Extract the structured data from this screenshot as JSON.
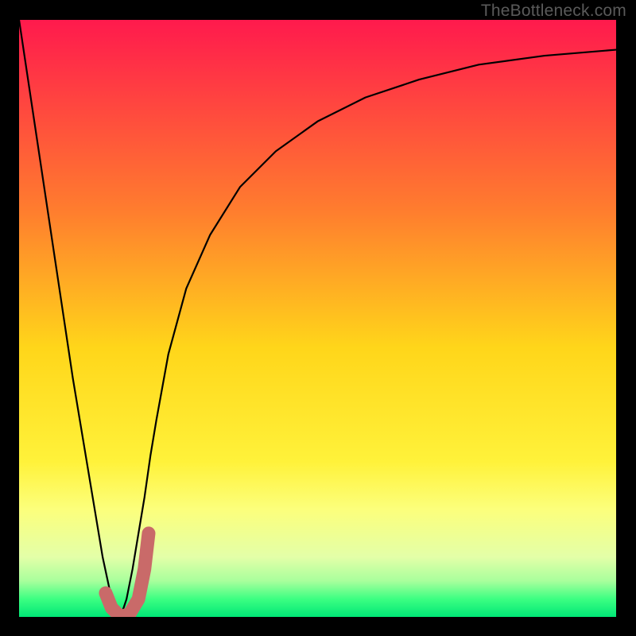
{
  "watermark": {
    "text": "TheBottleneck.com"
  },
  "chart_data": {
    "type": "line",
    "title": "",
    "xlabel": "",
    "ylabel": "",
    "xlim": [
      0,
      100
    ],
    "ylim": [
      0,
      100
    ],
    "grid": false,
    "legend": false,
    "background_gradient_stops": [
      {
        "pos": 0.0,
        "color": "#ff1a4d"
      },
      {
        "pos": 0.32,
        "color": "#ff7d2e"
      },
      {
        "pos": 0.55,
        "color": "#ffd61a"
      },
      {
        "pos": 0.74,
        "color": "#fff23a"
      },
      {
        "pos": 0.82,
        "color": "#fcff7c"
      },
      {
        "pos": 0.9,
        "color": "#e3ffa8"
      },
      {
        "pos": 0.94,
        "color": "#a8ff9c"
      },
      {
        "pos": 0.97,
        "color": "#3cff82"
      },
      {
        "pos": 1.0,
        "color": "#00e676"
      }
    ],
    "series": [
      {
        "name": "bottleneck-curve",
        "color": "#000000",
        "width": 2.2,
        "x": [
          0,
          3,
          6,
          9,
          12,
          14,
          15.5,
          17,
          18,
          19,
          20,
          21,
          22,
          23,
          25,
          28,
          32,
          37,
          43,
          50,
          58,
          67,
          77,
          88,
          100
        ],
        "values": [
          100,
          80,
          60,
          40,
          22,
          10,
          3,
          0,
          3,
          8,
          14,
          20,
          27,
          33,
          44,
          55,
          64,
          72,
          78,
          83,
          87,
          90,
          92.5,
          94,
          95
        ]
      },
      {
        "name": "highlight-j-marker",
        "color": "#c96a69",
        "width": 17,
        "x": [
          14.5,
          15.5,
          17.0,
          18.5,
          20.0,
          21.0,
          21.7
        ],
        "values": [
          4.0,
          1.5,
          0.0,
          0.5,
          3.0,
          8.0,
          14.0
        ]
      }
    ]
  }
}
